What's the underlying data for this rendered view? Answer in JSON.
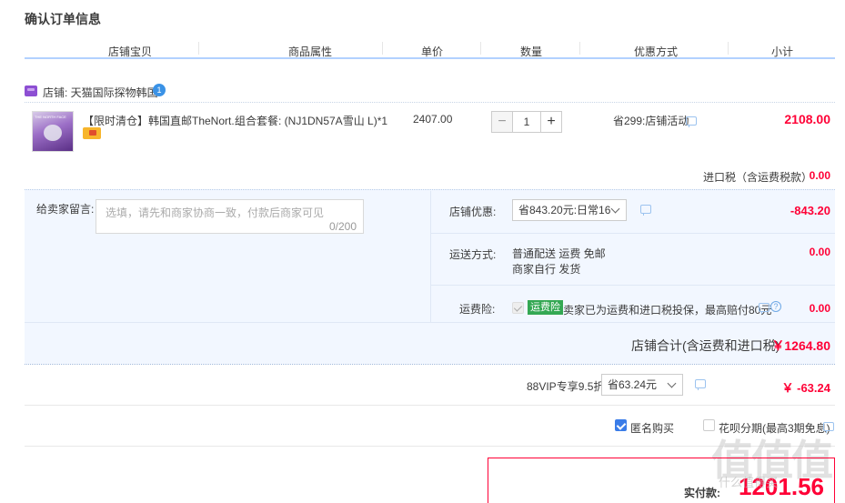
{
  "page_title": "确认订单信息",
  "columns": [
    "店铺宝贝",
    "商品属性",
    "单价",
    "数量",
    "优惠方式",
    "小计"
  ],
  "shop": {
    "label": "店铺: 天猫国际探物韩国",
    "badge": "1"
  },
  "item": {
    "name": "【限时清仓】韩国直邮TheNort...",
    "attributes": "组合套餐: (NJ1DN57A雪山 L)*1",
    "unit_price": "2407.00",
    "quantity": "1",
    "promo": "省299:店铺活动",
    "subtotal": "2108.00",
    "qty_minus": "−",
    "qty_plus": "+"
  },
  "import_tax": {
    "label": "进口税（含运费税款）",
    "value": "0.00"
  },
  "message": {
    "label": "给卖家留言:",
    "placeholder": "选填，请先和商家协商一致，付款后商家可见",
    "count": "0/200"
  },
  "shop_discount": {
    "label": "店铺优惠:",
    "selected": "省843.20元:日常16",
    "value": "-843.20"
  },
  "shipping": {
    "label": "运送方式:",
    "line1": "普通配送 运费 免邮",
    "line2": "商家自行  发货",
    "value": "0.00"
  },
  "insurance": {
    "label": "运费险:",
    "badge": "运费险",
    "text": "卖家已为运费和进口税投保，最高赔付80元",
    "help": "?",
    "value": "0.00"
  },
  "shop_total": {
    "label": "店铺合计(含运费和进口税)",
    "value": "￥1264.80"
  },
  "vip": {
    "label": "88VIP专享9.5折",
    "selected": "省63.24元",
    "value": "￥ -63.24"
  },
  "options": {
    "anonymous": "匿名购买",
    "installment": "花呗分期(最高3期免息)"
  },
  "final": {
    "label": "实付款:",
    "value": "1201.56"
  },
  "watermark": {
    "main": "值值值",
    "sub": "什么值得买"
  },
  "colors": {
    "accent_red": "#ff0036",
    "link_blue": "#3a7ce8",
    "panel_bg": "#f2f7ff",
    "shop_purple": "#8d4fd3"
  }
}
